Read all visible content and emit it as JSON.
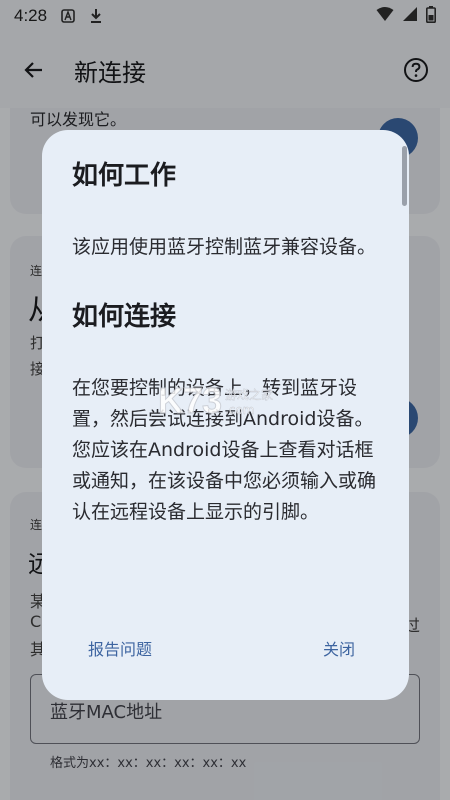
{
  "status_bar": {
    "time": "4:28",
    "icons": [
      "app-a-icon",
      "download-icon",
      "wifi-icon",
      "signal-icon",
      "battery-icon"
    ]
  },
  "app_bar": {
    "title": "新连接",
    "back_icon": "arrow-left-icon",
    "help_icon": "help-circle-icon"
  },
  "background": {
    "card1_text": "可以发现它。",
    "card2_label": "连",
    "card2_heading": "从",
    "card2_line1": "打",
    "card2_line2": "接",
    "card3_label": "连",
    "card3_heading": "远",
    "card3_line1": "某",
    "card3_line2": "C",
    "card3_line2_end": "过",
    "card3_line3": "其",
    "mac_input_placeholder": "蓝牙MAC地址",
    "mac_input_hint": "格式为xx：xx：xx：xx：xx：xx"
  },
  "dialog": {
    "section1_title": "如何工作",
    "section1_body": "该应用使用蓝牙控制蓝牙兼容设备。",
    "section2_title": "如何连接",
    "section2_body": "在您要控制的设备上，转到蓝牙设置，然后尝试连接到Android设备。您应该在Android设备上查看对话框或通知，在该设备中您必须输入或确认在远程设备上显示的引脚。",
    "report_button": "报告问题",
    "close_button": "关闭"
  },
  "watermark": {
    "main": "K73",
    "sub_top": "游戏之家",
    "sub_bottom": ".com"
  },
  "colors": {
    "accent": "#3d64a0",
    "dialog_bg": "#e7eef7",
    "card_bg": "#eef1f7"
  }
}
